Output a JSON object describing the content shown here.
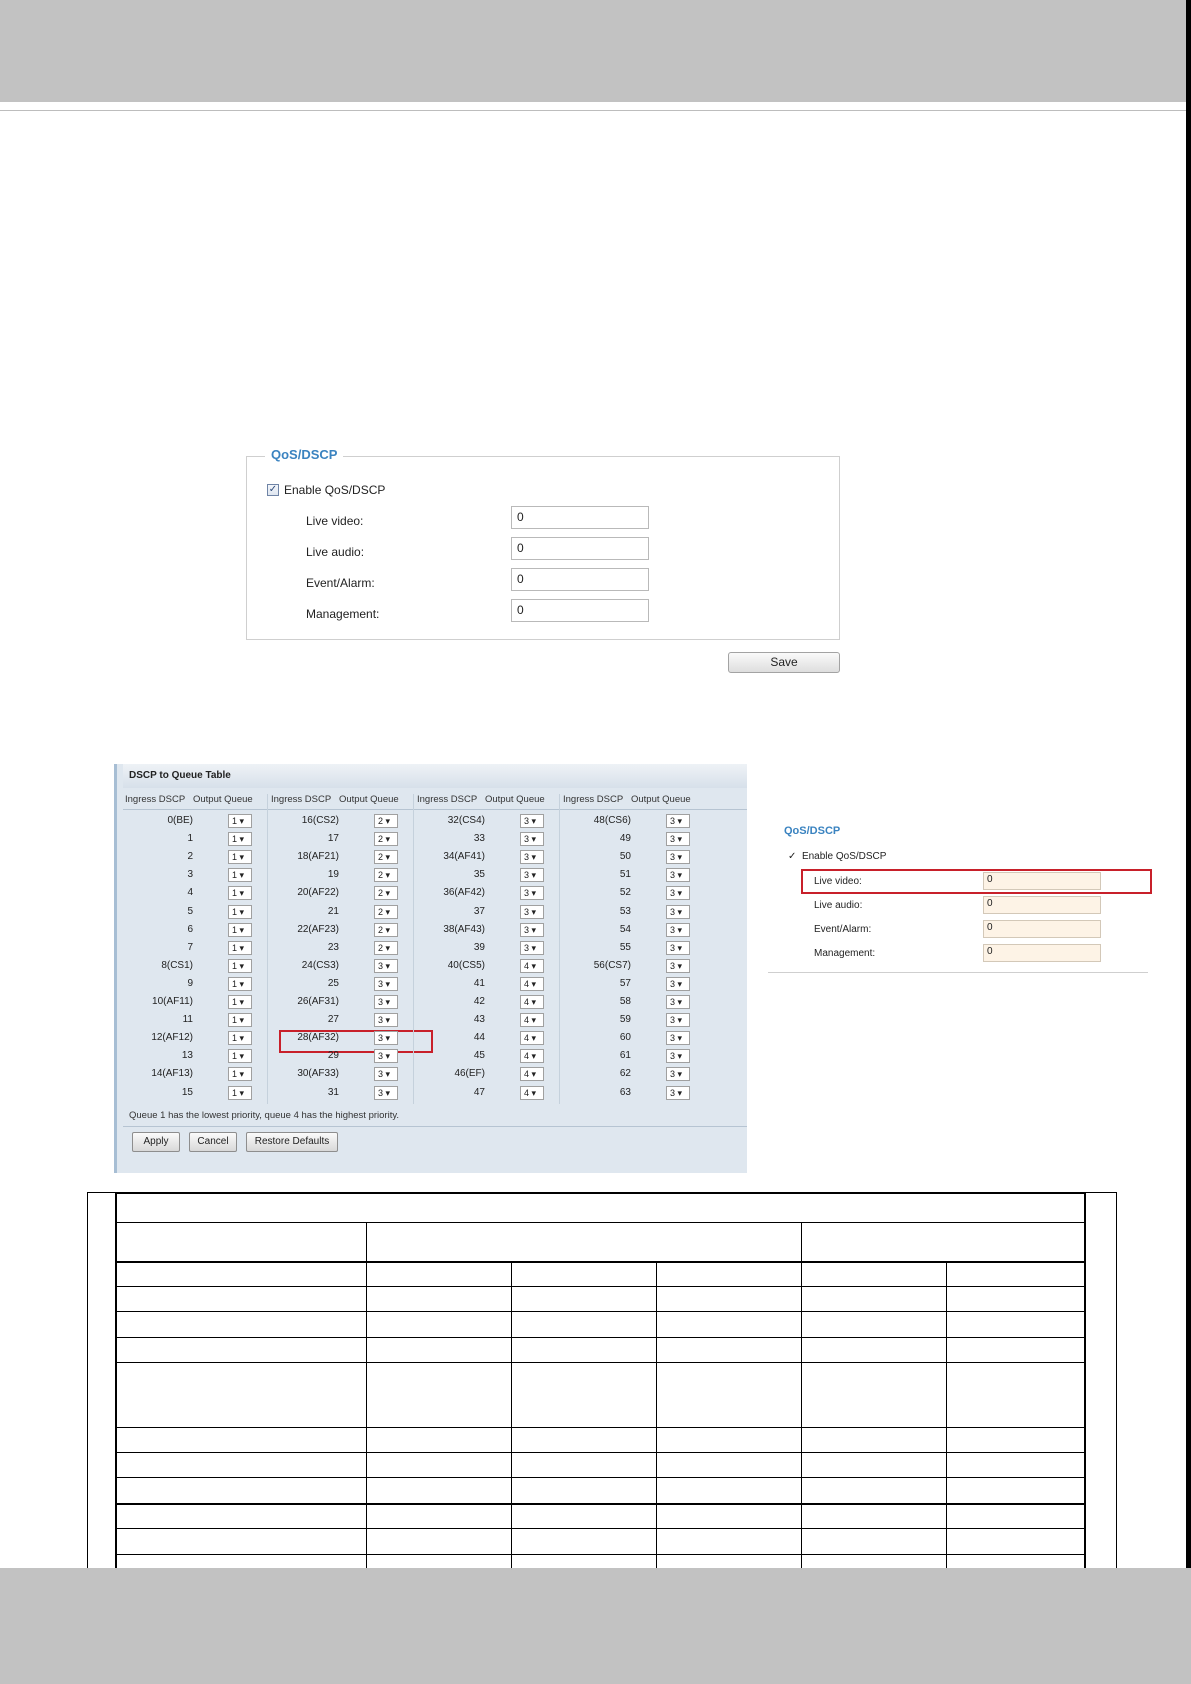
{
  "qos_panel": {
    "legend": "QoS/DSCP",
    "enable_label": "Enable QoS/DSCP",
    "enabled": true,
    "rows": [
      {
        "label": "Live video:",
        "value": "0"
      },
      {
        "label": "Live audio:",
        "value": "0"
      },
      {
        "label": "Event/Alarm:",
        "value": "0"
      },
      {
        "label": "Management:",
        "value": "0"
      }
    ],
    "save_label": "Save"
  },
  "dscp_table": {
    "title": "DSCP to Queue Table",
    "header_ingress": "Ingress DSCP",
    "header_output": "Output Queue",
    "columns": [
      {
        "ingress": [
          "0(BE)",
          "1",
          "2",
          "3",
          "4",
          "5",
          "6",
          "7",
          "8(CS1)",
          "9",
          "10(AF11)",
          "11",
          "12(AF12)",
          "13",
          "14(AF13)",
          "15"
        ],
        "queue": [
          "1",
          "1",
          "1",
          "1",
          "1",
          "1",
          "1",
          "1",
          "1",
          "1",
          "1",
          "1",
          "1",
          "1",
          "1",
          "1"
        ]
      },
      {
        "ingress": [
          "16(CS2)",
          "17",
          "18(AF21)",
          "19",
          "20(AF22)",
          "21",
          "22(AF23)",
          "23",
          "24(CS3)",
          "25",
          "26(AF31)",
          "27",
          "28(AF32)",
          "29",
          "30(AF33)",
          "31"
        ],
        "queue": [
          "2",
          "2",
          "2",
          "2",
          "2",
          "2",
          "2",
          "2",
          "3",
          "3",
          "3",
          "3",
          "3",
          "3",
          "3",
          "3"
        ]
      },
      {
        "ingress": [
          "32(CS4)",
          "33",
          "34(AF41)",
          "35",
          "36(AF42)",
          "37",
          "38(AF43)",
          "39",
          "40(CS5)",
          "41",
          "42",
          "43",
          "44",
          "45",
          "46(EF)",
          "47"
        ],
        "queue": [
          "3",
          "3",
          "3",
          "3",
          "3",
          "3",
          "3",
          "3",
          "4",
          "4",
          "4",
          "4",
          "4",
          "4",
          "4",
          "4"
        ]
      },
      {
        "ingress": [
          "48(CS6)",
          "49",
          "50",
          "51",
          "52",
          "53",
          "54",
          "55",
          "56(CS7)",
          "57",
          "58",
          "59",
          "60",
          "61",
          "62",
          "63"
        ],
        "queue": [
          "3",
          "3",
          "3",
          "3",
          "3",
          "3",
          "3",
          "3",
          "3",
          "3",
          "3",
          "3",
          "3",
          "3",
          "3",
          "3"
        ]
      }
    ],
    "note": "Queue 1 has the lowest priority, queue 4 has the highest priority.",
    "buttons": {
      "apply": "Apply",
      "cancel": "Cancel",
      "restore": "Restore Defaults"
    }
  },
  "mini_panel": {
    "legend": "QoS/DSCP",
    "enable_label": "Enable QoS/DSCP",
    "rows": [
      {
        "label": "Live video:",
        "value": "0"
      },
      {
        "label": "Live audio:",
        "value": "0"
      },
      {
        "label": "Event/Alarm:",
        "value": "0"
      },
      {
        "label": "Management:",
        "value": "0"
      }
    ]
  }
}
